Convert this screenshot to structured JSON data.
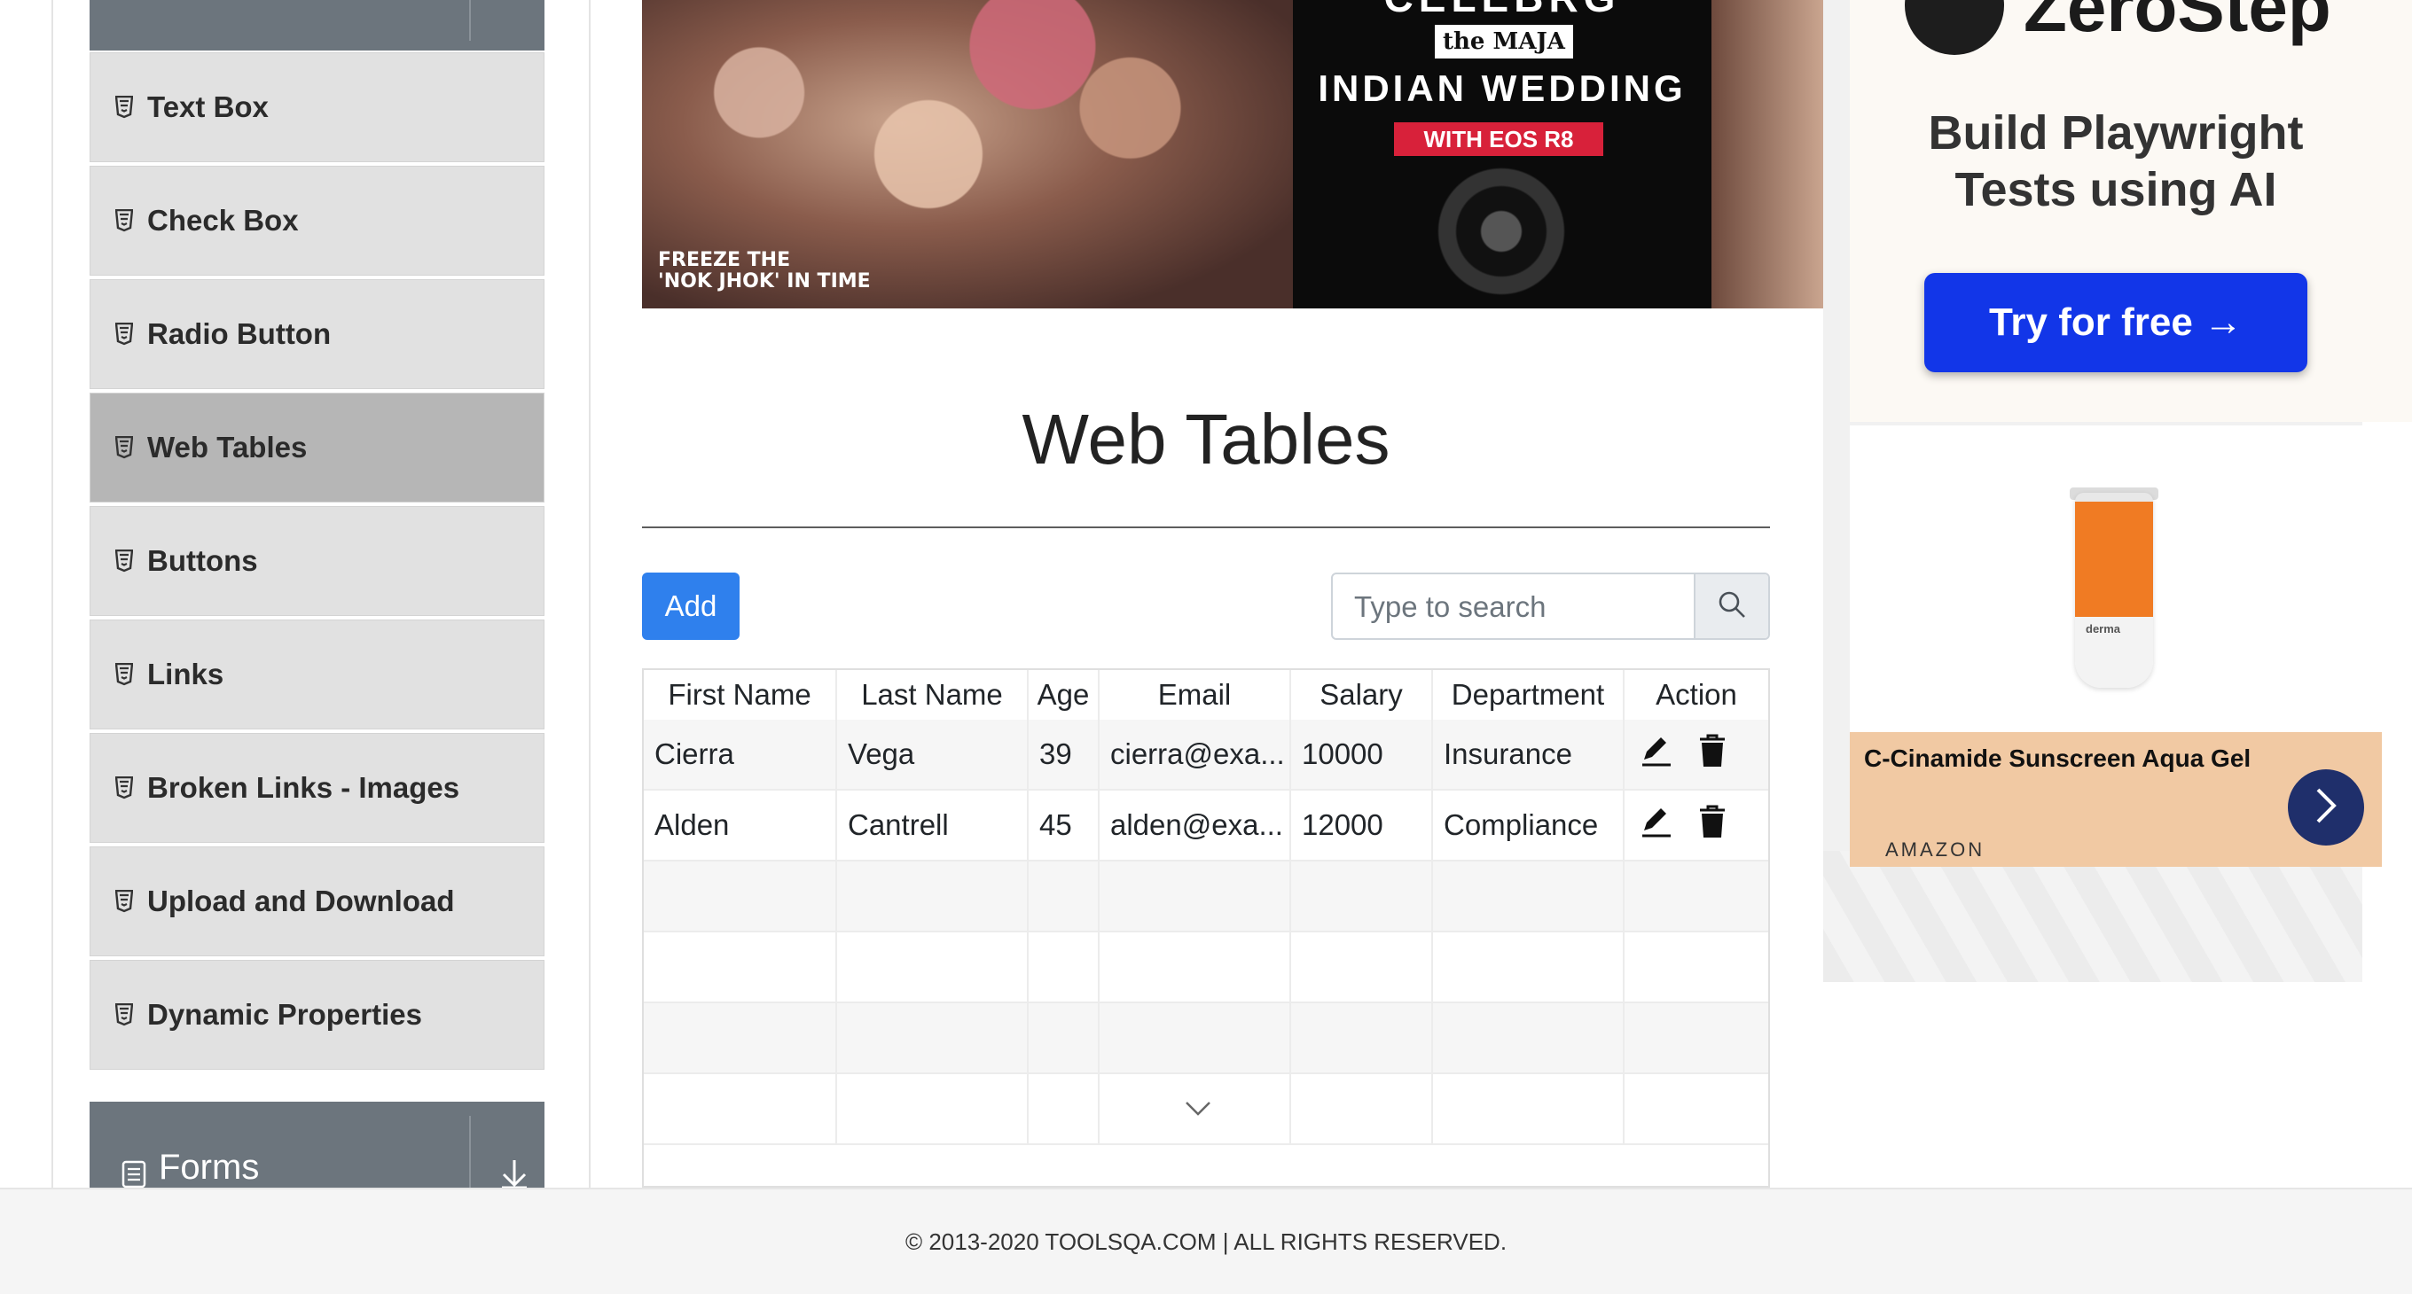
{
  "sidebar": {
    "items": [
      {
        "label": "Text Box",
        "active": false
      },
      {
        "label": "Check Box",
        "active": false
      },
      {
        "label": "Radio Button",
        "active": false
      },
      {
        "label": "Web Tables",
        "active": true
      },
      {
        "label": "Buttons",
        "active": false
      },
      {
        "label": "Links",
        "active": false
      },
      {
        "label": "Broken Links - Images",
        "active": false
      },
      {
        "label": "Upload and Download",
        "active": false
      },
      {
        "label": "Dynamic Properties",
        "active": false
      }
    ],
    "next_group": {
      "title": "Forms"
    }
  },
  "banner_ad": {
    "caption_line1": "FREEZE THE",
    "caption_line2": "'NOK JHOK' IN TIME",
    "line_top": "CELEBRG",
    "line_the": "the",
    "line_maja": "MAJA",
    "line_wedding": "INDIAN WEDDING",
    "line_with": "WITH",
    "line_model": "EOS R8"
  },
  "main": {
    "title": "Web Tables",
    "add_label": "Add",
    "search_placeholder": "Type to search",
    "table": {
      "headers": [
        "First Name",
        "Last Name",
        "Age",
        "Email",
        "Salary",
        "Department",
        "Action"
      ],
      "rows": [
        {
          "first": "Cierra",
          "last": "Vega",
          "age": "39",
          "email": "cierra@exa...",
          "salary": "10000",
          "department": "Insurance"
        },
        {
          "first": "Alden",
          "last": "Cantrell",
          "age": "45",
          "email": "alden@exa...",
          "salary": "12000",
          "department": "Compliance"
        }
      ],
      "empty_rows": 4
    }
  },
  "ad_zerostep": {
    "brand": "ZeroStep",
    "tagline_line1": "Build Playwright",
    "tagline_line2": "Tests using AI",
    "cta": "Try for free →"
  },
  "ad_product": {
    "name": "C-Cinamide Sunscreen Aqua Gel",
    "seller": "AMAZON",
    "brand_on_tube": "derma"
  },
  "footer": {
    "text": "© 2013-2020 TOOLSQA.COM | ALL RIGHTS RESERVED."
  },
  "colors": {
    "accent": "#2f80ed",
    "sidebar_group": "#6c757d",
    "cta": "#1236e8"
  }
}
